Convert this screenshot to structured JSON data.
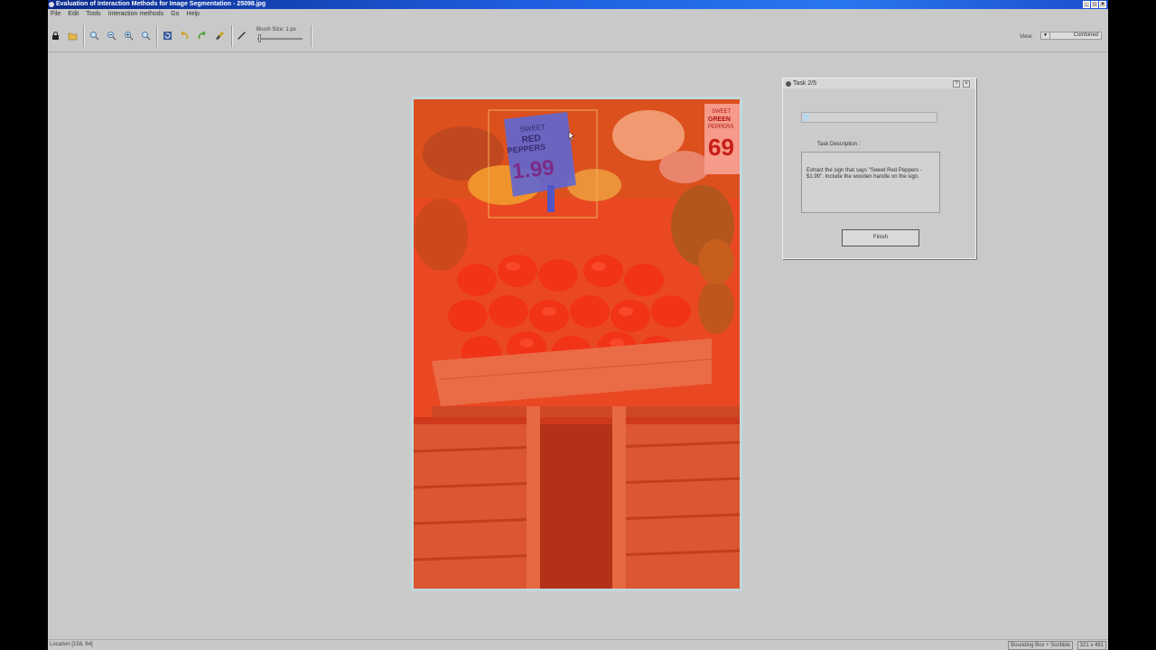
{
  "window": {
    "title": "Evaluation of Interaction Methods for Image Segmentation - 25098.jpg"
  },
  "menu": [
    "File",
    "Edit",
    "Tools",
    "Interaction methods",
    "Go",
    "Help"
  ],
  "toolbar": {
    "tools": [
      "lock-icon",
      "open-folder-icon",
      "zoom-fit-icon",
      "zoom-out-icon",
      "zoom-in-icon",
      "zoom-actual-icon",
      "refresh-icon",
      "undo-icon",
      "redo-icon",
      "brush-icon",
      "pen-icon"
    ],
    "brush_size_label": "Brush Size: 1 px",
    "view_label": "View:",
    "view_value": "Combined"
  },
  "image": {
    "sign_text_1": "SWEET",
    "sign_text_2": "RED",
    "sign_text_3": "PEPPERS",
    "sign_price": "1.99",
    "right_sign_text_1": "SWEET",
    "right_sign_text_2": "GREEN",
    "right_sign_text_3": "PEPPERS",
    "right_sign_price": "69",
    "overlay_color": "#e8431f",
    "selection_color": "#4d6fe8"
  },
  "task": {
    "title": "Task 2/5",
    "progress": 0.05,
    "description_label": "Task Description :",
    "description": "Extract the sign that says \"Sweet Red Peppers - $1.99\". Include the wooden handle on the sign.",
    "finish_label": "Finish"
  },
  "status": {
    "location": "Location [158, 64]",
    "mode": "Bounding Box + Scribble",
    "size": "321 x 481"
  }
}
